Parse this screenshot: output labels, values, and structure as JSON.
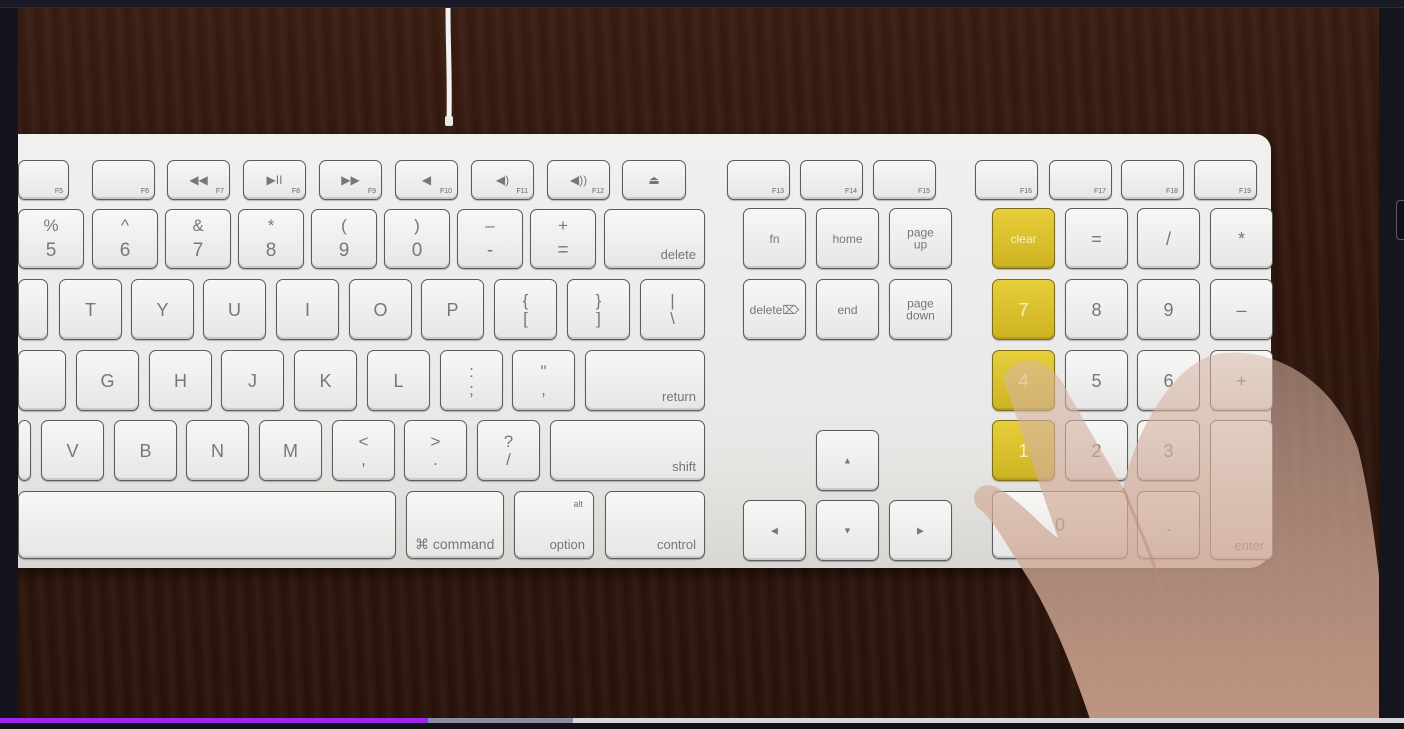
{
  "player": {
    "progress_played_fraction": 0.305,
    "progress_buffered_fraction": 0.408,
    "accent_color": "#a125f0"
  },
  "keyboard": {
    "function_row": [
      "F5",
      "F6",
      "F7",
      "F8",
      "F9",
      "F10",
      "F11",
      "F12"
    ],
    "function_row_right": [
      "F13",
      "F14",
      "F15",
      "F16",
      "F17",
      "F18",
      "F19"
    ],
    "number_row": [
      {
        "top": "%",
        "bottom": "5"
      },
      {
        "top": "^",
        "bottom": "6"
      },
      {
        "top": "&",
        "bottom": "7"
      },
      {
        "top": "*",
        "bottom": "8"
      },
      {
        "top": "(",
        "bottom": "9"
      },
      {
        "top": ")",
        "bottom": "0"
      },
      {
        "top": "–",
        "bottom": "-"
      },
      {
        "top": "+",
        "bottom": "="
      }
    ],
    "delete_label": "delete",
    "qwerty_row": [
      "T",
      "Y",
      "U",
      "I",
      "O",
      "P"
    ],
    "bracket_keys": [
      {
        "top": "{",
        "bottom": "["
      },
      {
        "top": "}",
        "bottom": "]"
      },
      {
        "top": "|",
        "bottom": "\\"
      }
    ],
    "home_row": [
      "G",
      "H",
      "J",
      "K",
      "L"
    ],
    "home_punct": [
      {
        "top": ":",
        "bottom": ";"
      },
      {
        "top": "\"",
        "bottom": ","
      }
    ],
    "return_label": "return",
    "bottom_row": [
      "V",
      "B",
      "N",
      "M"
    ],
    "bottom_punct": [
      {
        "top": "<",
        "bottom": ","
      },
      {
        "top": ">",
        "bottom": "."
      },
      {
        "top": "?",
        "bottom": "/"
      }
    ],
    "shift_label": "shift",
    "command_symbol": "⌘",
    "command_label": "command",
    "option_alt": "alt",
    "option_label": "option",
    "control_label": "control",
    "nav_keys": {
      "fn": "fn",
      "home": "home",
      "page_up": "page\nup",
      "delete_fwd": "delete",
      "delete_fwd_icon": "⌦",
      "end": "end",
      "page_down": "page\ndown"
    },
    "arrows": {
      "up": "▲",
      "left": "◀",
      "down": "▼",
      "right": "▶"
    },
    "media_icons": {
      "rewind": "◀◀",
      "play_pause": "▶II",
      "forward": "▶▶",
      "mute": "◀",
      "vol_down": "◀)",
      "vol_up": "◀))",
      "eject": "⏏"
    },
    "numpad": {
      "row1": [
        "clear",
        "=",
        "/",
        "*"
      ],
      "row2": [
        "7",
        "8",
        "9",
        "–"
      ],
      "row3": [
        "4",
        "5",
        "6",
        "+"
      ],
      "row4": [
        "1",
        "2",
        "3"
      ],
      "row5": [
        "0",
        "."
      ],
      "enter": "enter"
    }
  }
}
